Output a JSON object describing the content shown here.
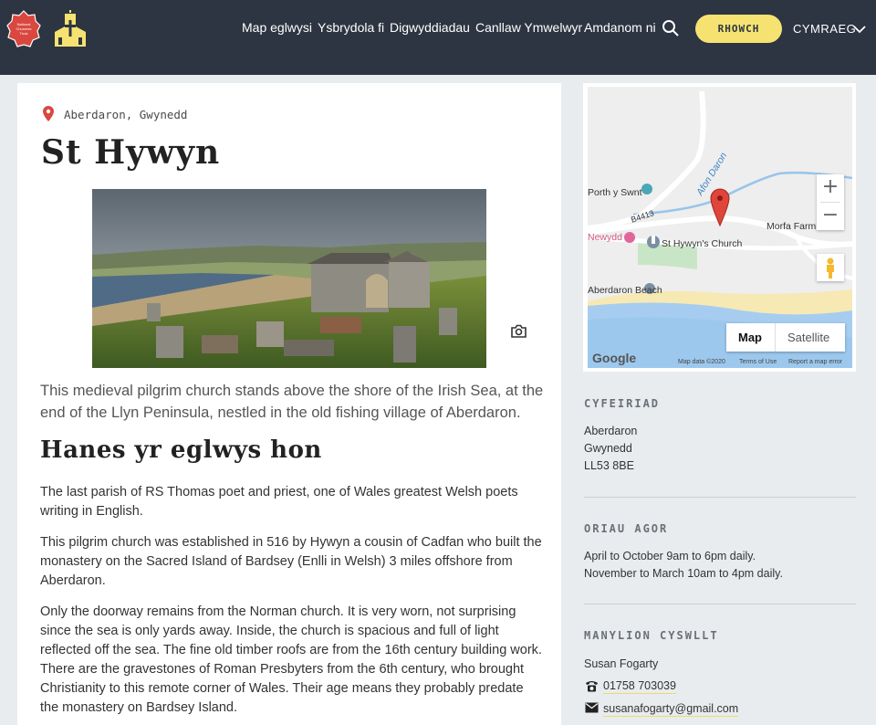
{
  "header": {
    "nav": [
      {
        "label": "Map eglwysi"
      },
      {
        "label": "Ysbrydola fi"
      },
      {
        "label": "Digwyddiadau"
      },
      {
        "label": "Canllaw Ymwelwyr"
      },
      {
        "label": "Amdanom ni"
      }
    ],
    "cta_label": "RHOWCH",
    "language": "CYMRAEG",
    "colors": {
      "bar": "#2c3541",
      "cta": "#f6e271",
      "logo_red": "#d9473f",
      "logo_yellow": "#f6e271"
    },
    "icons": [
      "national-churches-trust-logo",
      "church-logo",
      "search-icon",
      "chevron-down-icon"
    ]
  },
  "church": {
    "location": "Aberdaron, Gwynedd",
    "name": "St Hywyn",
    "intro": "This medieval pilgrim church stands above the shore of the Irish Sea, at the end of the Llyn Peninsula, nestled in the old fishing village of Aberdaron.",
    "history_heading": "Hanes yr eglwys hon",
    "paragraphs": [
      "The last parish of RS Thomas poet and priest, one of Wales greatest Welsh poets writing in English.",
      "This pilgrim church was established in 516 by Hywyn a cousin of Cadfan who built the monastery on the Sacred Island of Bardsey (Enlli in Welsh) 3 miles offshore from Aberdaron.",
      "Only the doorway remains from the Norman church. It is very worn, not surprising since the sea is only yards away. Inside, the church is spacious and full of light reflected off the sea. The fine old timber roofs are from the 16th century building work. There are the gravestones of Roman Presbyters from the 6th century, who brought Christianity to this remote corner of Wales. Their age means they probably predate the monastery on Bardsey Island."
    ]
  },
  "map": {
    "labels": {
      "road_b4413": "B4413",
      "road_top": "B4413",
      "river": "Afon Daron",
      "porth": "Porth y Swnt",
      "morfa": "Morfa Farm",
      "newydd": "Newydd",
      "church": "St Hywyn's Church",
      "beach": "Aberdaron Beach"
    },
    "zoom_in": "+",
    "zoom_out": "−",
    "type_map": "Map",
    "type_satellite": "Satellite",
    "google": "Google",
    "attrib": {
      "data": "Map data ©2020",
      "terms": "Terms of Use",
      "report": "Report a map error"
    }
  },
  "sidebar": {
    "address_heading": "CYFEIRIAD",
    "address": [
      "Aberdaron",
      "Gwynedd",
      "LL53 8BE"
    ],
    "hours_heading": "ORIAU AGOR",
    "hours": [
      "April to October 9am to 6pm daily.",
      "November to March 10am to 4pm daily."
    ],
    "contact_heading": "MANYLION CYSWLLT",
    "contact_name": "Susan Fogarty",
    "phone": "01758 703039",
    "email": "susanafogarty@gmail.com"
  }
}
